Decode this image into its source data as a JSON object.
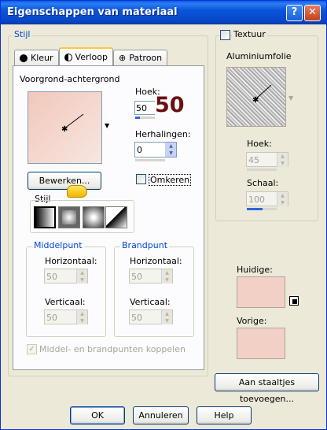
{
  "window": {
    "title": "Eigenschappen van materiaal",
    "help_glyph": "?",
    "close_glyph": "✕"
  },
  "stijl_group": {
    "label": "Stijl"
  },
  "tabs": [
    {
      "label": "Kleur",
      "icon": "filled-circle-icon"
    },
    {
      "label": "Verloop",
      "icon": "half-circle-icon"
    },
    {
      "label": "Patroon",
      "icon": "grid-icon"
    }
  ],
  "gradient": {
    "preview_label": "Voorgrond-achtergrond",
    "angle_label": "Hoek:",
    "angle_value": "50",
    "angle_overlay": "50",
    "repeats_label": "Herhalingen:",
    "repeats_value": "0",
    "edit_button": "Bewerken...",
    "invert_label": "Omkeren",
    "style_label": "Stijl"
  },
  "midpoint": {
    "label": "Middelpunt",
    "horizontal_label": "Horizontaal:",
    "horizontal_value": "50",
    "vertical_label": "Verticaal:",
    "vertical_value": "50"
  },
  "focalpoint": {
    "label": "Brandpunt",
    "horizontal_label": "Horizontaal:",
    "horizontal_value": "50",
    "vertical_label": "Verticaal:",
    "vertical_value": "50"
  },
  "link_points_label": "Middel- en brandpunten koppelen",
  "texture": {
    "label": "Textuur",
    "name": "Aluminiumfolie",
    "angle_label": "Hoek:",
    "angle_value": "45",
    "scale_label": "Schaal:",
    "scale_value": "100"
  },
  "current_label": "Huidige:",
  "previous_label": "Vorige:",
  "add_swatches_button": "Aan staaltjes toevoegen...",
  "footer": {
    "ok": "OK",
    "cancel": "Annuleren",
    "help": "Help"
  },
  "colors": {
    "accent": "#0046d5",
    "overlay_number": "#6b0f0f",
    "swatch": "#f2d0c6"
  }
}
